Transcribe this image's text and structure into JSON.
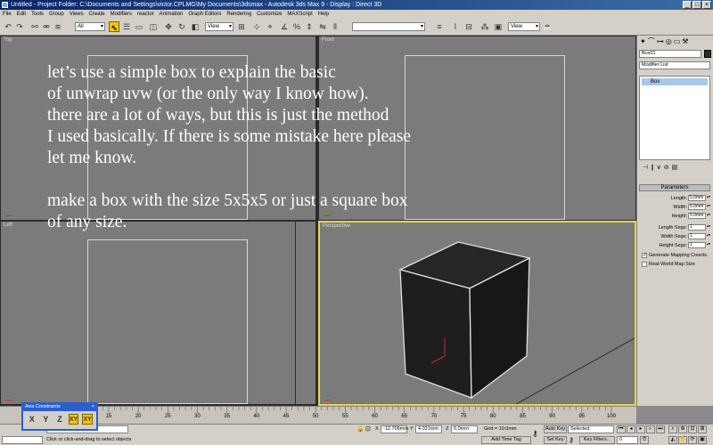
{
  "window": {
    "title": "Untitled   - Project Folder: C:\\Documents and Settings\\victor.CPLMG\\My Documents\\3dsmax    - Autodesk 3ds Max 9      - Display : Direct 3D",
    "minimize": "_",
    "maximize": "□",
    "close": "×"
  },
  "menu": [
    "File",
    "Edit",
    "Tools",
    "Group",
    "Views",
    "Create",
    "Modifiers",
    "reactor",
    "Animation",
    "Graph Editors",
    "Rendering",
    "Customize",
    "MAXScript",
    "Help"
  ],
  "toolbar": {
    "selection_filter": "All",
    "reference_coord": "View",
    "named_selection": "",
    "render_view": "View",
    "icons": [
      "undo-icon",
      "redo-icon",
      "link-icon",
      "unlink-icon",
      "bind-icon",
      "select-icon",
      "select-by-name-icon",
      "region-icon",
      "window-crossing-icon",
      "move-icon",
      "rotate-icon",
      "scale-icon",
      "pivot-icon",
      "manipulate-icon",
      "snap-icon",
      "angle-snap-icon",
      "percent-snap-icon",
      "spinner-snap-icon",
      "mirror-icon",
      "align-icon",
      "layers-icon",
      "curve-editor-icon",
      "schematic-icon",
      "material-editor-icon",
      "render-setup-icon",
      "quick-render-icon",
      "teapot-icon"
    ]
  },
  "viewports": {
    "top_label": "Top",
    "front_label": "Front",
    "left_label": "Left",
    "persp_label": "Perspective"
  },
  "overlay_text": "let’s use a simple box to explain the basic\nof unwrap uvw (or the only way I know how).\nthere are a lot of ways, but this is just the method\nI used basically. If there is some mistake here please\nlet me know.\n\nmake a box with the size 5x5x5 or just a square box\nof any size.",
  "command_panel": {
    "object_name": "Box01",
    "object_color": "#2b2b2b",
    "modifier_list": "Modifier List",
    "stack_item": "Box",
    "rollout_title": "Parameters",
    "params": [
      {
        "label": "Length:",
        "value": "5.0mm"
      },
      {
        "label": "Width:",
        "value": "5.0mm"
      },
      {
        "label": "Height:",
        "value": "5.0mm"
      },
      {
        "label": "Length Segs:",
        "value": "1"
      },
      {
        "label": "Width Segs:",
        "value": "1"
      },
      {
        "label": "Height Segs:",
        "value": "1"
      }
    ],
    "gen_mapping": "Generate Mapping Coords.",
    "gen_mapping_checked": "✓",
    "real_world": "Real-World Map Size"
  },
  "timeline": {
    "ticks": [
      "15",
      "20",
      "25",
      "30",
      "35",
      "40",
      "45",
      "50",
      "55",
      "60",
      "65",
      "70",
      "75",
      "80",
      "85",
      "90",
      "95",
      "100"
    ],
    "tick_values": [
      15,
      20,
      25,
      30,
      35,
      40,
      45,
      50,
      55,
      60,
      65,
      70,
      75,
      80,
      85,
      90,
      95,
      100
    ]
  },
  "axis_constraints": {
    "title": "Axis Constraints",
    "close": "×",
    "x": "X",
    "y": "Y",
    "z": "Z",
    "xy": "XY",
    "yz": "XY"
  },
  "statusbar": {
    "selected": "1 Object Selected",
    "prompt": "Click or click-and-drag to select objects",
    "x_label": "X",
    "x_value": "-12.706mm",
    "y_label": "Y",
    "y_value": "4.021mm",
    "z_label": "Z",
    "z_value": "0.0mm",
    "grid": "Grid = 10.0mm",
    "add_time_tag": "Add Time Tag",
    "auto_key": "Auto Key",
    "set_key": "Set Key",
    "selected_dropdown": "Selected",
    "key_filters": "Key Filters...",
    "frame": "0"
  }
}
